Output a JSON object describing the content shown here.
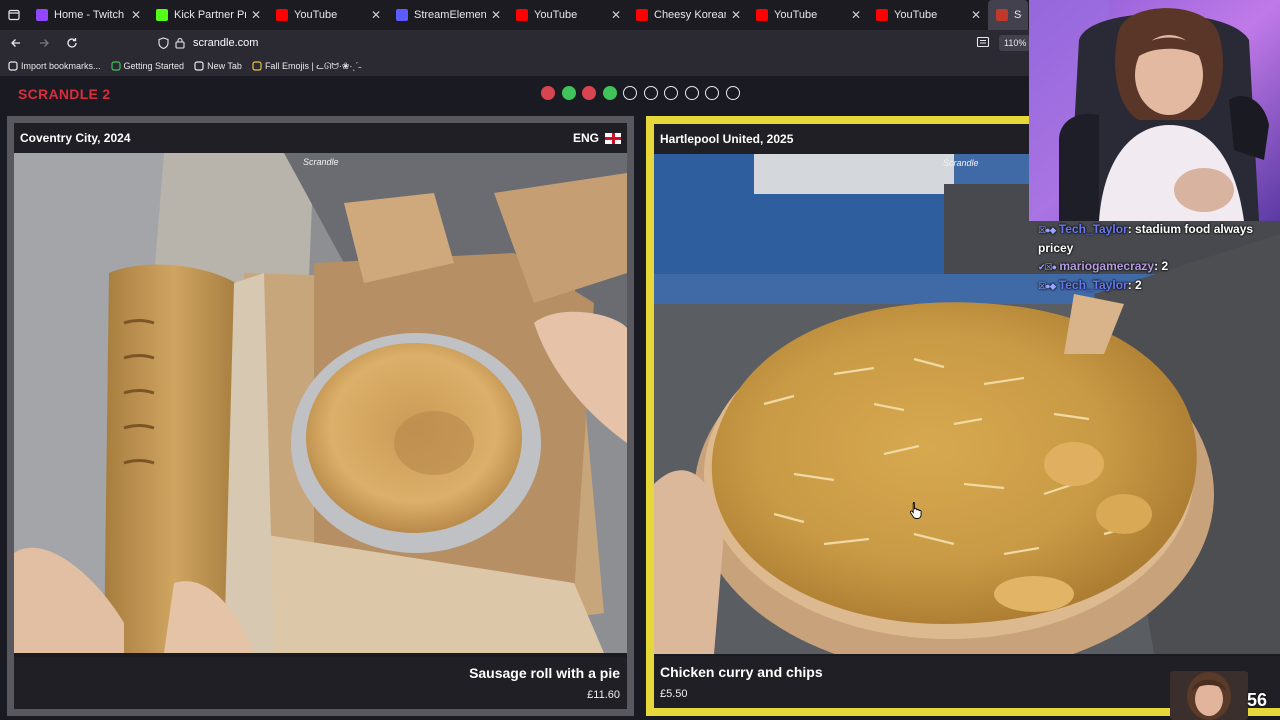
{
  "browser": {
    "tabs": [
      {
        "title": "Home - Twitch",
        "favicon": "twitch-icon",
        "color": "#9146ff",
        "active": false
      },
      {
        "title": "Kick Partner Program -",
        "favicon": "kick-icon",
        "color": "#53fc18",
        "active": false
      },
      {
        "title": "YouTube",
        "favicon": "youtube-icon",
        "color": "#ff0000",
        "active": false
      },
      {
        "title": "StreamElements - My c",
        "favicon": "streamelements-icon",
        "color": "#5b5bff",
        "active": false
      },
      {
        "title": "YouTube",
        "favicon": "youtube-icon",
        "color": "#ff0000",
        "active": false
      },
      {
        "title": "Cheesy Korean Egg Toa",
        "favicon": "youtube-icon",
        "color": "#ff0000",
        "active": false
      },
      {
        "title": "YouTube",
        "favicon": "youtube-icon",
        "color": "#ff0000",
        "active": false
      },
      {
        "title": "YouTube",
        "favicon": "youtube-icon",
        "color": "#ff0000",
        "active": false
      },
      {
        "title": "Scran",
        "favicon": "scrandle-icon",
        "color": "#c0392b",
        "active": true
      }
    ],
    "url": "scrandle.com",
    "zoom": "110%",
    "bookmarks": [
      {
        "label": "Import bookmarks...",
        "icon": "import-icon"
      },
      {
        "label": "Getting Started",
        "icon": "firefox-icon"
      },
      {
        "label": "New Tab",
        "icon": "globe-icon"
      },
      {
        "label": "Fall Emojis | ᓚᘏᗢ·❀·ˎˊ˗",
        "icon": "folder-icon"
      }
    ]
  },
  "app": {
    "title": "SCRANDLE 2",
    "progress_dots": [
      "red",
      "green",
      "red",
      "green",
      "empty",
      "empty",
      "empty",
      "empty",
      "empty",
      "empty"
    ]
  },
  "cards": {
    "left": {
      "club": "Coventry City, 2024",
      "lang": "ENG",
      "watermark": "Scrandle",
      "food": "Sausage roll with a pie",
      "price": "£11.60"
    },
    "right": {
      "club": "Hartlepool United, 2025",
      "watermark": "Scrandle",
      "food": "Chicken curry and chips",
      "price": "£5.50"
    }
  },
  "overlay": {
    "chat": [
      {
        "badges": "☒●◆",
        "user": "Tech_Taylor",
        "message": "stadium food always pricey"
      },
      {
        "badges": "✔☒●",
        "user": "mariogamecrazy",
        "message": "2"
      },
      {
        "badges": "☒●◆",
        "user": "Tech_Taylor",
        "message": "2"
      }
    ],
    "viewer_count": "56"
  }
}
